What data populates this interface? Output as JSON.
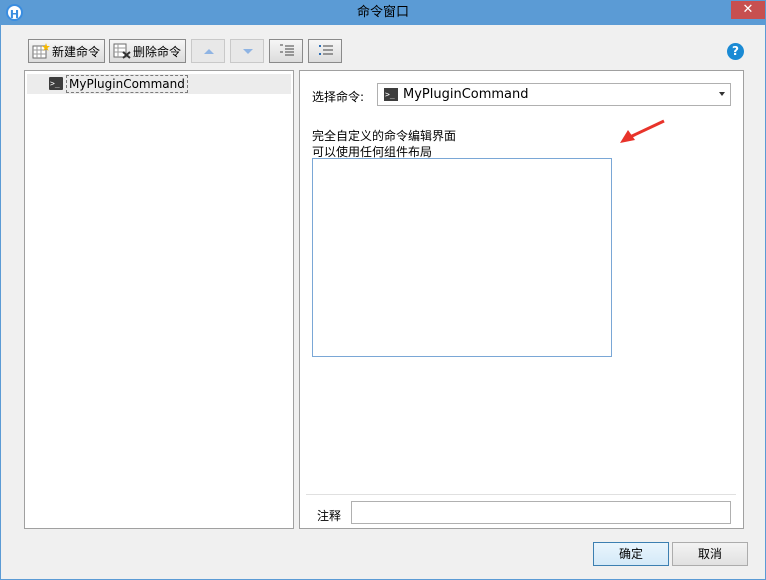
{
  "window": {
    "title": "命令窗口",
    "app_icon": "H",
    "close_glyph": "✕"
  },
  "toolbar": {
    "new_command": "新建命令",
    "delete_command": "删除命令",
    "icons": [
      "new-command-icon",
      "delete-command-icon",
      "move-up-icon",
      "move-down-icon",
      "indent-icon",
      "outdent-icon"
    ]
  },
  "help_glyph": "?",
  "tree": {
    "items": [
      {
        "label": "MyPluginCommand",
        "icon_text": ">_"
      }
    ]
  },
  "editor": {
    "select_label": "选择命令:",
    "selected_command": "MyPluginCommand",
    "desc_line1": "完全自定义的命令编辑界面",
    "desc_line2": "可以使用任何组件布局",
    "note_label": "注释",
    "note_value": ""
  },
  "footer": {
    "ok": "确定",
    "cancel": "取消"
  },
  "colors": {
    "titlebar": "#5b9bd5",
    "close": "#c75050",
    "arrow": "#e8332a",
    "accent": "#1a8ad4"
  }
}
